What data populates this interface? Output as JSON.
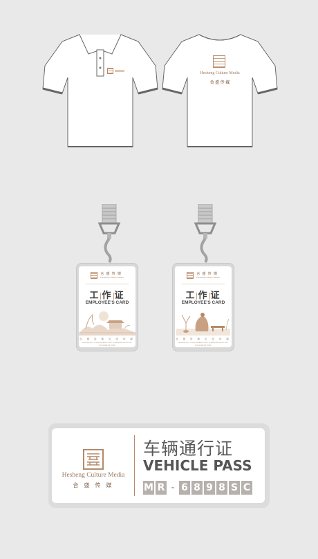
{
  "colors": {
    "background": "#e9e9e9",
    "accent": "#b58a6a",
    "text_dark": "#555555"
  },
  "shirt_front": {
    "logo_icon": "company-seal-icon"
  },
  "shirt_back": {
    "logo_icon": "company-seal-icon",
    "company_en": "Hesheng Culture Media",
    "company_cn": "合 盛 传 媒"
  },
  "badges": [
    {
      "brand_cn": "合 盛 传 媒",
      "brand_en": "Hesheng Culture Media",
      "title_chars": [
        "工",
        "作",
        "证"
      ],
      "subtitle": "EMPLOYEE'S CARD",
      "bottom_cn": "合 盛 传 媒 文 化 传 媒",
      "bottom_en": "MINGHUI COOPERATION PRESERVATION FOUNDATION",
      "scene_icon": "pavilion-landscape-icon"
    },
    {
      "brand_cn": "合 盛 传 媒",
      "brand_en": "Hesheng Culture Media",
      "title_chars": [
        "工",
        "作",
        "证"
      ],
      "subtitle": "EMPLOYEE'S CARD",
      "bottom_cn": "合 盛 传 媒 文 化 传 媒",
      "bottom_en": "MINGHUI COOPERATION PRESERVATION FOUNDATION",
      "scene_icon": "scholar-figure-icon"
    }
  ],
  "vehicle_pass": {
    "company_en": "Hesheng Culture Media",
    "company_cn": "合 盛 传 媒",
    "title_cn": "车辆通行证",
    "title_en": "VEHICLE PASS",
    "plate": [
      "M",
      "R",
      "-",
      "6",
      "8",
      "9",
      "8",
      "S",
      "C"
    ]
  }
}
